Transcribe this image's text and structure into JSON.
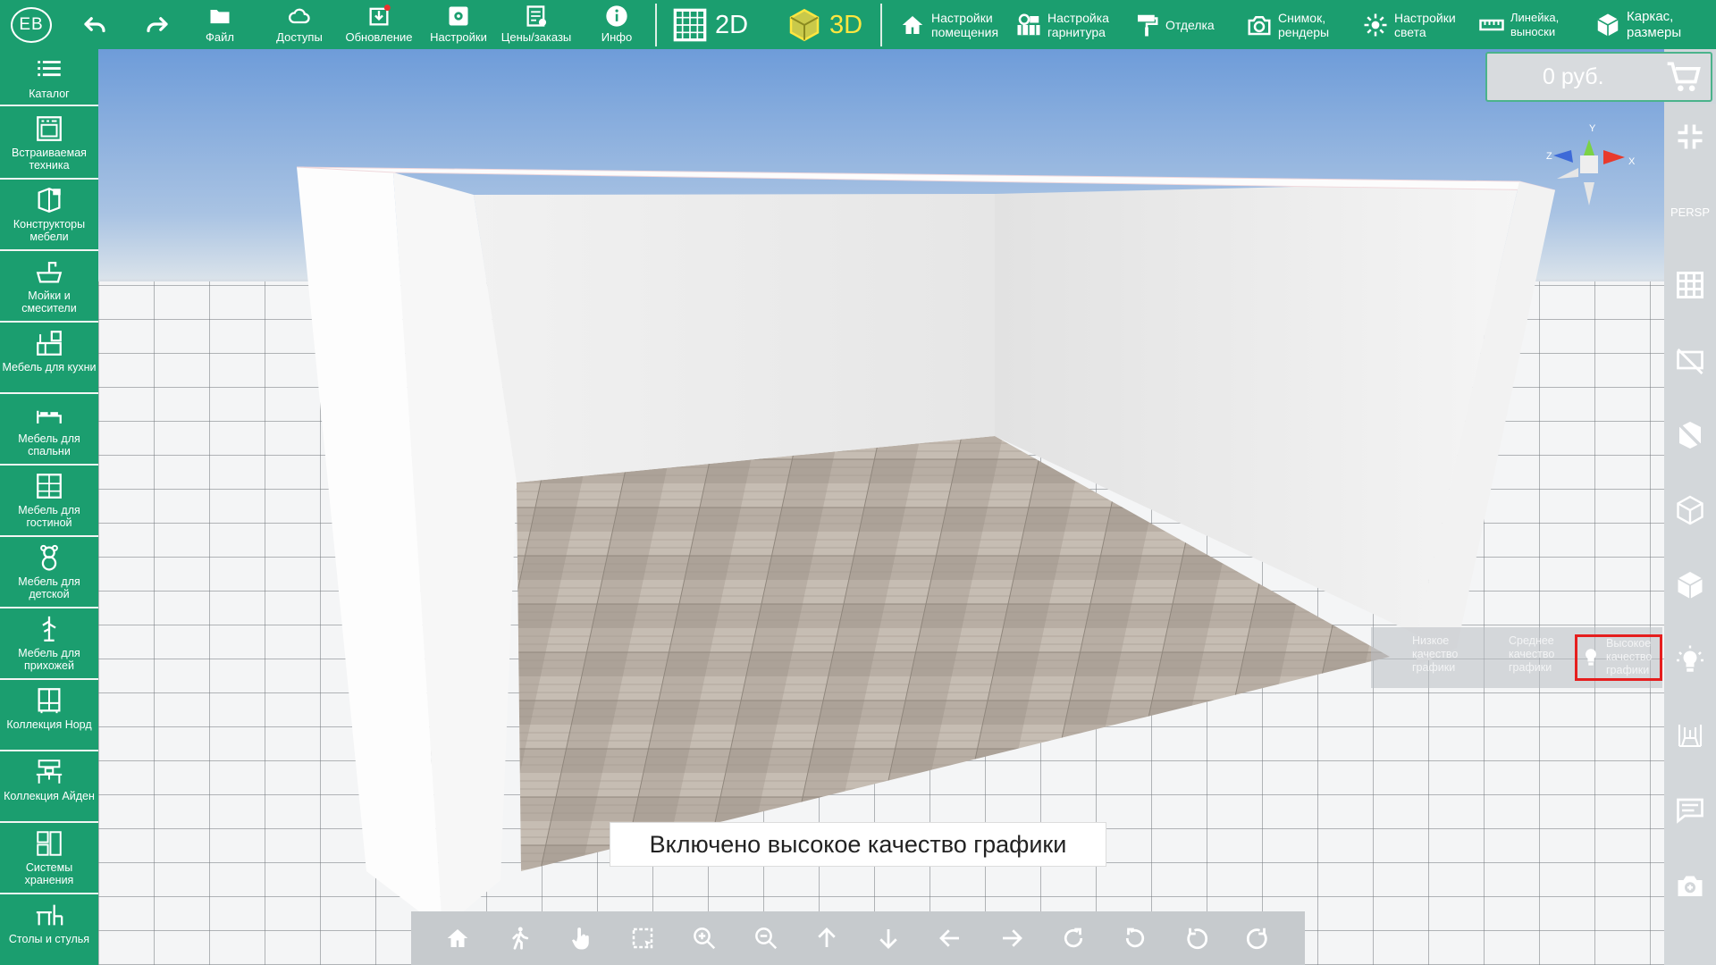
{
  "user": {
    "initials": "EB"
  },
  "toolbar": {
    "undo_icon": "undo-icon",
    "redo_icon": "redo-icon",
    "buttons": [
      {
        "label": "Файл",
        "icon": "folder-icon"
      },
      {
        "label": "Доступы",
        "icon": "cloud-icon"
      },
      {
        "label": "Обновление",
        "icon": "download-icon"
      },
      {
        "label": "Настройки",
        "icon": "settings-icon"
      },
      {
        "label": "Цены/заказы",
        "icon": "price-list-icon"
      },
      {
        "label": "Инфо",
        "icon": "info-icon"
      }
    ],
    "mode_2d": "2D",
    "mode_3d": "3D",
    "active_mode": "3D",
    "wide_buttons": [
      {
        "line1": "Настройки",
        "line2": "помещения",
        "icon": "house-icon"
      },
      {
        "line1": "Настройка",
        "line2": "гарнитура",
        "icon": "furniture-settings-icon"
      },
      {
        "line1": "Отделка",
        "line2": "",
        "icon": "paint-roller-icon"
      },
      {
        "line1": "Снимок,",
        "line2": "рендеры",
        "icon": "camera-icon"
      },
      {
        "line1": "Настройки",
        "line2": "света",
        "icon": "light-icon"
      },
      {
        "line1": "Линейка,",
        "line2": "выноски",
        "icon": "ruler-icon"
      },
      {
        "line1": "Каркас,",
        "line2": "размеры",
        "icon": "box-icon"
      }
    ]
  },
  "sidebar": {
    "items": [
      {
        "label": "Каталог",
        "icon": "list-icon"
      },
      {
        "label": "Встраиваемая техника",
        "icon": "oven-icon"
      },
      {
        "label": "Конструкторы мебели",
        "icon": "furniture-builder-icon"
      },
      {
        "label": "Мойки и смесители",
        "icon": "sink-icon"
      },
      {
        "label": "Мебель для кухни",
        "icon": "kitchen-icon"
      },
      {
        "label": "Мебель для спальни",
        "icon": "bed-icon"
      },
      {
        "label": "Мебель для гостиной",
        "icon": "living-room-icon"
      },
      {
        "label": "Мебель для детской",
        "icon": "teddy-bear-icon"
      },
      {
        "label": "Мебель для прихожей",
        "icon": "hanger-icon"
      },
      {
        "label": "Коллекция Норд",
        "icon": "wardrobe-icon"
      },
      {
        "label": "Коллекция Айден",
        "icon": "desk-icon"
      },
      {
        "label": "Системы хранения",
        "icon": "storage-icon"
      },
      {
        "label": "Столы и стулья",
        "icon": "table-chair-icon"
      }
    ]
  },
  "price": {
    "value": "0 руб.",
    "icon": "cart-icon"
  },
  "right_bar": {
    "persp_label": "PERSP",
    "items": [
      "collapse-icon",
      "persp-label",
      "grid-icon",
      "no-screen-icon",
      "hide-walls-icon",
      "wireframe-cube-icon",
      "solid-cube-icon",
      "light-bulb-icon",
      "dimension-icon",
      "comment-icon",
      "screenshot-icon"
    ]
  },
  "quality": {
    "options": [
      {
        "line1": "Низкое",
        "line2": "качество",
        "line3": "графики"
      },
      {
        "line1": "Среднее",
        "line2": "качество",
        "line3": "графики"
      },
      {
        "line1": "Высокое",
        "line2": "качество",
        "line3": "графики"
      }
    ],
    "selected": "Высокое"
  },
  "gizmo": {
    "x": "X",
    "y": "Y",
    "z": "Z"
  },
  "toast": {
    "message": "Включено высокое качество графики"
  },
  "bottom_nav": [
    "home-icon",
    "walk-icon",
    "hand-pointer-icon",
    "select-area-icon",
    "zoom-in-icon",
    "zoom-out-icon",
    "arrow-up-icon",
    "arrow-down-icon",
    "arrow-left-icon",
    "arrow-right-icon",
    "rotate-cw-icon",
    "rotate-ccw-icon",
    "rotate-left-icon",
    "rotate-right-icon"
  ],
  "colors": {
    "toolbar_bg": "#1b9e6f",
    "active_mode": "#ffe640",
    "quality_highlight": "#e51e1e"
  }
}
